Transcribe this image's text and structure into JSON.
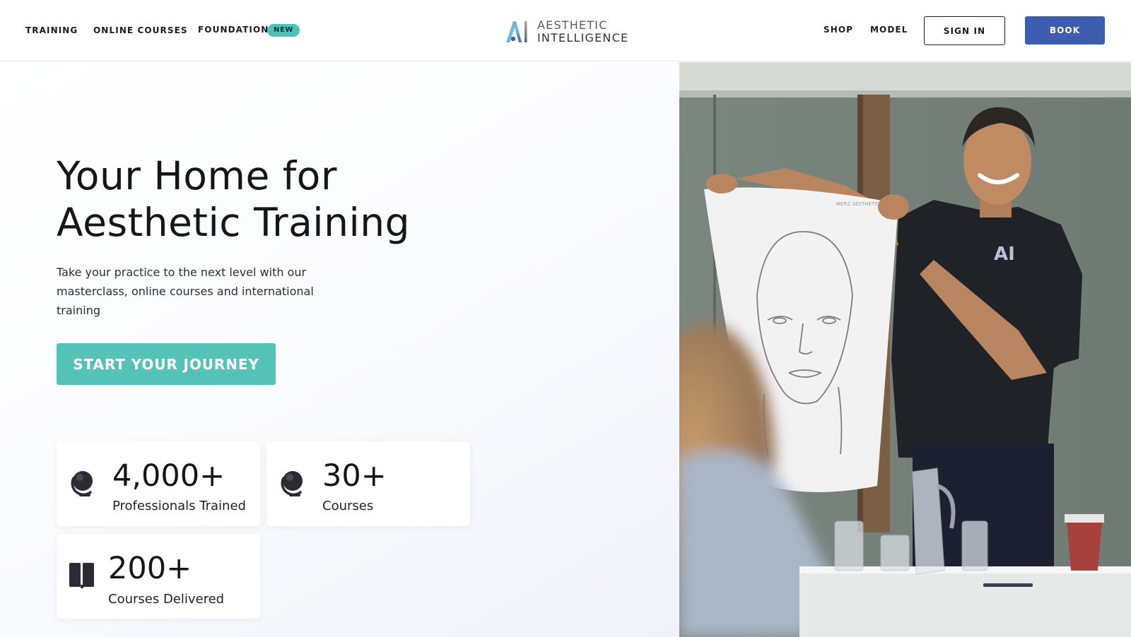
{
  "header": {
    "nav_left": [
      {
        "label": "TRAINING"
      },
      {
        "label": "ONLINE COURSES"
      },
      {
        "label": "FOUNDATION",
        "badge": "NEW"
      }
    ],
    "logo": {
      "line1": "AESTHETIC",
      "line2": "INTELLIGENCE",
      "icon": "ai-logo-icon"
    },
    "nav_right": [
      {
        "label": "SHOP"
      },
      {
        "label": "MODEL"
      }
    ],
    "sign_in_label": "SIGN IN",
    "book_label": "BOOK"
  },
  "hero": {
    "title_line1": "Your Home for",
    "title_line2": "Aesthetic Training",
    "subtitle": "Take your practice to the next level with our masterclass, online courses and international training",
    "cta_label": "START YOUR JOURNEY",
    "photo_chart_text": "MERZ AESTHETICS"
  },
  "stats": [
    {
      "value": "4,000+",
      "label": "Professionals Trained",
      "icon": "globe-icon"
    },
    {
      "value": "30+",
      "label": "Courses",
      "icon": "globe-icon"
    },
    {
      "value": "200+",
      "label": "Courses Delivered",
      "icon": "book-icon"
    }
  ],
  "colors": {
    "accent_teal": "#55c2b7",
    "primary_blue": "#3d5eb0",
    "text_dark": "#15151a"
  }
}
